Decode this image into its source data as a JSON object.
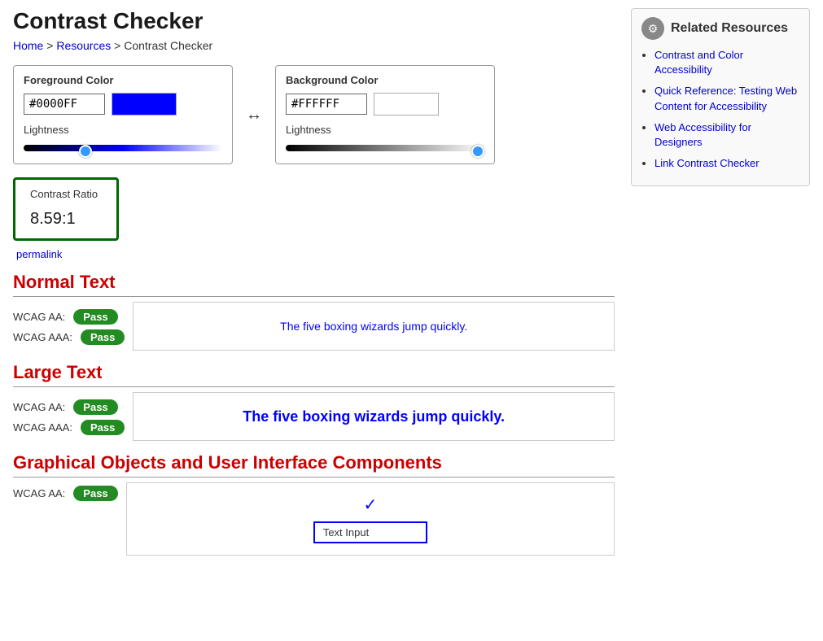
{
  "page": {
    "title": "Contrast Checker",
    "breadcrumb": {
      "home": "Home",
      "resources": "Resources",
      "current": "Contrast Checker"
    }
  },
  "foreground": {
    "label": "Foreground Color",
    "hex": "#0000FF",
    "swatch_color": "#0000FF",
    "lightness_label": "Lightness",
    "slider_value": 30
  },
  "background": {
    "label": "Background Color",
    "hex": "#FFFFFF",
    "swatch_color": "#FFFFFF",
    "lightness_label": "Lightness",
    "slider_value": 100
  },
  "swap_symbol": "↔",
  "contrast": {
    "label": "Contrast Ratio",
    "value": "8.59",
    "suffix": ":1",
    "permalink_text": "permalink"
  },
  "normal_text": {
    "title": "Normal Text",
    "wcag_aa_label": "WCAG AA:",
    "wcag_aaa_label": "WCAG AAA:",
    "pass_label": "Pass",
    "sample": "The five boxing wizards jump quickly."
  },
  "large_text": {
    "title": "Large Text",
    "wcag_aa_label": "WCAG AA:",
    "wcag_aaa_label": "WCAG AAA:",
    "pass_label": "Pass",
    "sample": "The five boxing wizards jump quickly."
  },
  "graphical": {
    "title": "Graphical Objects and User Interface Components",
    "wcag_aa_label": "WCAG AA:",
    "pass_label": "Pass",
    "checkmark": "✓",
    "text_input_label": "Text Input"
  },
  "sidebar": {
    "title": "Related Resources",
    "icon_symbol": "⚙",
    "links": [
      {
        "text": "Contrast and Color Accessibility"
      },
      {
        "text": "Quick Reference: Testing Web Content for Accessibility"
      },
      {
        "text": "Web Accessibility for Designers"
      },
      {
        "text": "Link Contrast Checker"
      }
    ]
  }
}
